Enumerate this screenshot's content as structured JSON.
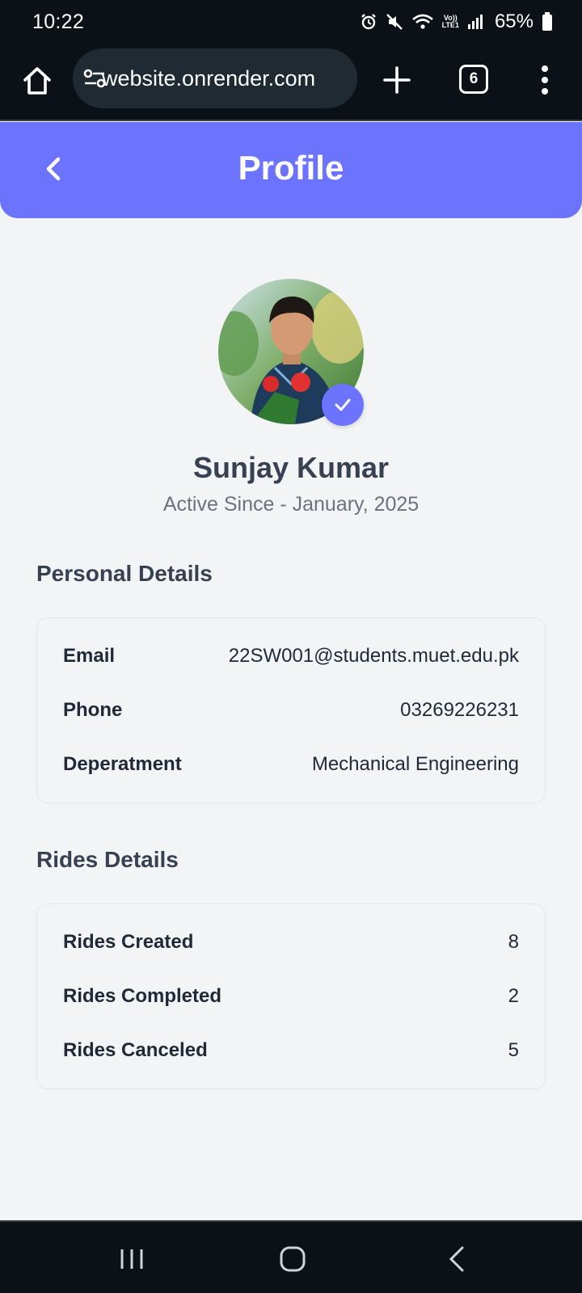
{
  "status_bar": {
    "time": "10:22",
    "network_label_top": "Vo))",
    "network_label_bottom": "LTE1",
    "battery": "65%"
  },
  "browser": {
    "url": "website.onrender.com",
    "tab_count": "6"
  },
  "header": {
    "title": "Profile",
    "accent_color": "#6b73ff"
  },
  "profile": {
    "name": "Sunjay Kumar",
    "active_since": "Active Since - January, 2025",
    "verified": true
  },
  "personal_details": {
    "title": "Personal Details",
    "rows": [
      {
        "label": "Email",
        "value": "22SW001@students.muet.edu.pk"
      },
      {
        "label": "Phone",
        "value": "03269226231"
      },
      {
        "label": "Deperatment",
        "value": "Mechanical Engineering"
      }
    ]
  },
  "rides_details": {
    "title": "Rides Details",
    "rows": [
      {
        "label": "Rides Created",
        "value": "8"
      },
      {
        "label": "Rides Completed",
        "value": "2"
      },
      {
        "label": "Rides Canceled",
        "value": "5"
      }
    ]
  },
  "icons": {
    "home": "home-icon",
    "site_settings": "tune-icon",
    "new_tab": "plus-icon",
    "tabs": "tab-switcher-icon",
    "menu": "more-vert-icon",
    "back": "chevron-left-icon",
    "verified": "check-icon"
  }
}
